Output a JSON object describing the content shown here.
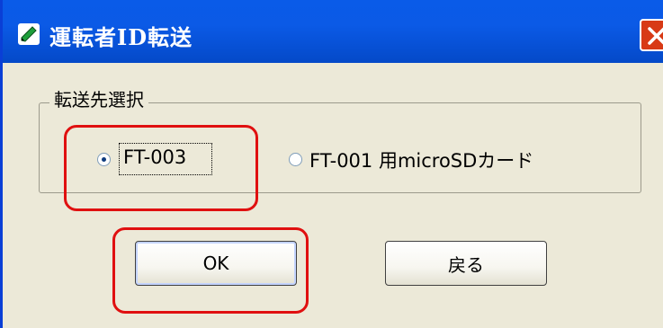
{
  "window": {
    "title": "運転者ID転送",
    "app_icon": "pen-icon",
    "close_icon": "close-icon"
  },
  "group": {
    "label": "転送先選択",
    "options": [
      {
        "label": "FT-003",
        "selected": true
      },
      {
        "label": "FT-001 用microSDカード",
        "selected": false
      }
    ]
  },
  "buttons": {
    "ok_label": "OK",
    "back_label": "戻る"
  },
  "colors": {
    "titlebar": "#0A5BE8",
    "dialog_bg": "#ECE9D8",
    "close_button": "#D83A16",
    "annotation": "#E01010"
  }
}
